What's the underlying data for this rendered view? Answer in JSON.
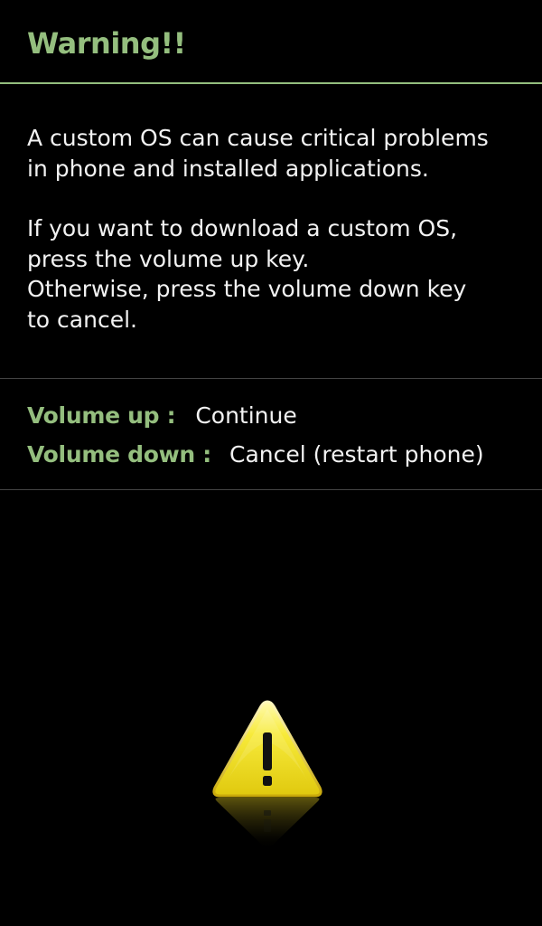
{
  "colors": {
    "accent": "#94be7e",
    "background": "#000000",
    "text": "#f2f2f2",
    "divider": "#444444",
    "warning_yellow": "#f2e21c"
  },
  "header": {
    "title": "Warning!!"
  },
  "message": {
    "lines_para1": [
      "A custom OS can cause critical problems",
      "in phone and installed applications."
    ],
    "lines_para2": [
      "If you want to download a custom OS,",
      "press the volume up key.",
      "Otherwise, press the volume down key",
      "to cancel."
    ]
  },
  "options": [
    {
      "key": "Volume up :",
      "action": "Continue"
    },
    {
      "key": "Volume down :",
      "action": "Cancel (restart phone)"
    }
  ],
  "graphic": {
    "icon": "warning-triangle-icon",
    "symbol": "!"
  }
}
